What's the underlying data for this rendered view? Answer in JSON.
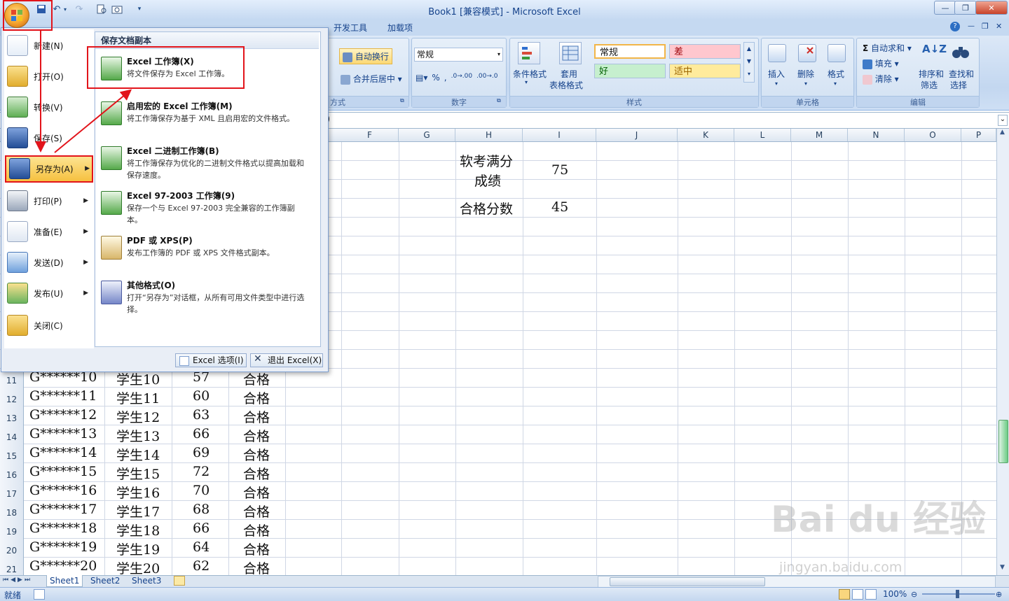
{
  "window": {
    "title": "Book1  [兼容模式] - Microsoft Excel",
    "min": "—",
    "restore": "❐",
    "close": "✕"
  },
  "ribbon": {
    "tabs": [
      "开发工具",
      "加载项"
    ],
    "help": "?",
    "wrap_text": "自动换行",
    "merge_center": "合并后居中",
    "number_format": "常规",
    "alignment_group_tail": "方式",
    "number_group": "数字",
    "cond_format": "条件格式",
    "table_format_1": "套用",
    "table_format_2": "表格格式",
    "styles": {
      "normal": "常规",
      "bad": "差",
      "good": "好",
      "neutral": "适中"
    },
    "styles_group": "样式",
    "insert": "插入",
    "delete": "删除",
    "format": "格式",
    "cells_group": "单元格",
    "autosum": "自动求和",
    "fill": "填充",
    "clear": "清除",
    "sort_filter_1": "排序和",
    "sort_filter_2": "筛选",
    "find_select_1": "查找和",
    "find_select_2": "选择",
    "editing_group": "编辑"
  },
  "columns": [
    "F",
    "G",
    "H",
    "I",
    "J",
    "K",
    "L",
    "M",
    "N",
    "O",
    "P"
  ],
  "cells": {
    "h1a": "软考满分",
    "h1b": "成绩",
    "i1": "75",
    "h2": "合格分数",
    "i2": "45"
  },
  "rows": [
    {
      "num": "11",
      "id": "G******10",
      "name": "学生10",
      "score": "57",
      "result": "合格"
    },
    {
      "num": "12",
      "id": "G******11",
      "name": "学生11",
      "score": "60",
      "result": "合格"
    },
    {
      "num": "13",
      "id": "G******12",
      "name": "学生12",
      "score": "63",
      "result": "合格"
    },
    {
      "num": "14",
      "id": "G******13",
      "name": "学生13",
      "score": "66",
      "result": "合格"
    },
    {
      "num": "15",
      "id": "G******14",
      "name": "学生14",
      "score": "69",
      "result": "合格"
    },
    {
      "num": "16",
      "id": "G******15",
      "name": "学生15",
      "score": "72",
      "result": "合格"
    },
    {
      "num": "17",
      "id": "G******16",
      "name": "学生16",
      "score": "70",
      "result": "合格"
    },
    {
      "num": "18",
      "id": "G******17",
      "name": "学生17",
      "score": "68",
      "result": "合格"
    },
    {
      "num": "19",
      "id": "G******18",
      "name": "学生18",
      "score": "66",
      "result": "合格"
    },
    {
      "num": "20",
      "id": "G******19",
      "name": "学生19",
      "score": "64",
      "result": "合格"
    },
    {
      "num": "21",
      "id": "G******20",
      "name": "学生20",
      "score": "62",
      "result": "合格"
    }
  ],
  "sheets": [
    "Sheet1",
    "Sheet2",
    "Sheet3"
  ],
  "status": {
    "ready": "就绪",
    "zoom": "100%"
  },
  "office_menu": {
    "items": [
      {
        "label": "新建(N)"
      },
      {
        "label": "打开(O)"
      },
      {
        "label": "转换(V)"
      },
      {
        "label": "保存(S)"
      },
      {
        "label": "另存为(A)"
      },
      {
        "label": "打印(P)"
      },
      {
        "label": "准备(E)"
      },
      {
        "label": "发送(D)"
      },
      {
        "label": "发布(U)"
      },
      {
        "label": "关闭(C)"
      }
    ],
    "submenu_title": "保存文档副本",
    "submenu": [
      {
        "title": "Excel 工作簿(X)",
        "desc": "将文件保存为 Excel 工作簿。"
      },
      {
        "title": "启用宏的 Excel 工作簿(M)",
        "desc": "将工作簿保存为基于 XML 且启用宏的文件格式。"
      },
      {
        "title": "Excel 二进制工作簿(B)",
        "desc": "将工作簿保存为优化的二进制文件格式以提高加载和保存速度。"
      },
      {
        "title": "Excel 97-2003 工作簿(9)",
        "desc": "保存一个与 Excel 97-2003 完全兼容的工作簿副本。"
      },
      {
        "title": "PDF 或 XPS(P)",
        "desc": "发布工作簿的 PDF 或 XPS 文件格式副本。"
      },
      {
        "title": "其他格式(O)",
        "desc": "打开“另存为”对话框，从所有可用文件类型中进行选择。"
      }
    ],
    "options_button": "Excel 选项(I)",
    "exit_button": "退出 Excel(X)"
  },
  "watermark": {
    "brand": "Bai du 经验",
    "url": "jingyan.baidu.com"
  },
  "colors": {
    "accent_red": "#e2141b",
    "ribbon_blue": "#c5d9f1",
    "menu_highlight": "#f6c140"
  }
}
